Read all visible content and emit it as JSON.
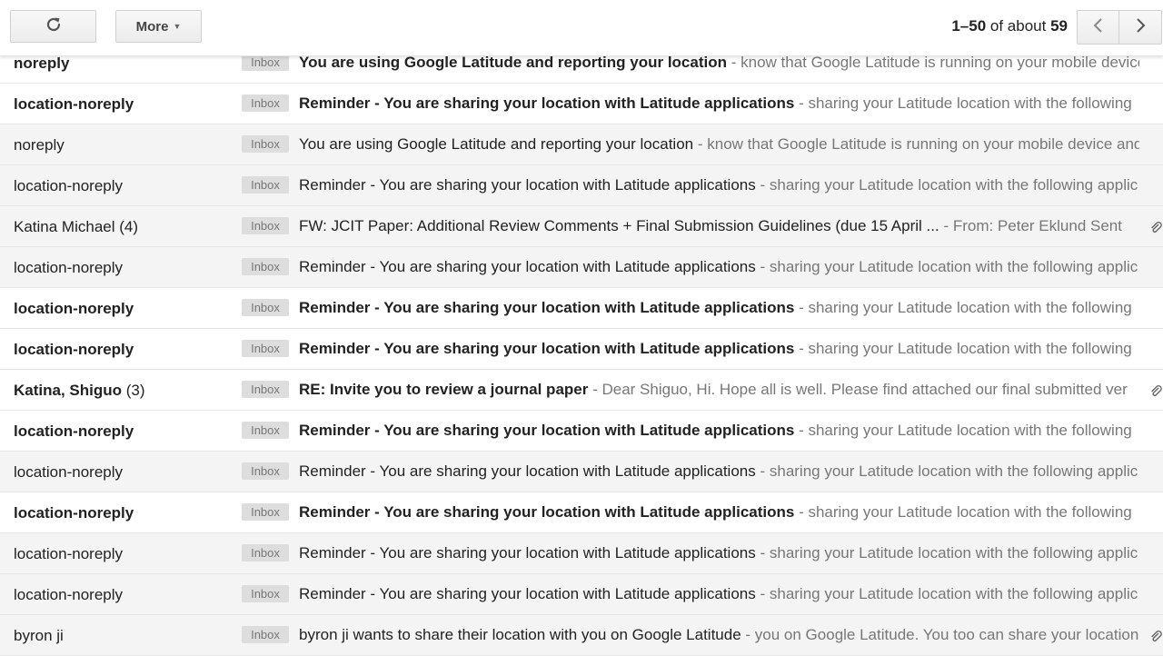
{
  "toolbar": {
    "refresh_icon": "refresh-icon",
    "more_label": "More",
    "pager": {
      "range": "1–50",
      "of_label": "of about",
      "total": "59"
    }
  },
  "emails": [
    {
      "sender": "noreply",
      "count": "",
      "label": "Inbox",
      "subject": "You are using Google Latitude and reporting your location",
      "sep": " - ",
      "snippet": "know that Google Latitude is running on your mobile device and",
      "unread": true,
      "attachment": false
    },
    {
      "sender": "location-noreply",
      "count": "",
      "label": "Inbox",
      "subject": "Reminder - You are sharing your location with Latitude applications",
      "sep": " - ",
      "snippet": "sharing your Latitude location with the following",
      "unread": true,
      "attachment": false
    },
    {
      "sender": "noreply",
      "count": "",
      "label": "Inbox",
      "subject": "You are using Google Latitude and reporting your location",
      "sep": " - ",
      "snippet": "know that Google Latitude is running on your mobile device and",
      "unread": false,
      "attachment": false
    },
    {
      "sender": "location-noreply",
      "count": "",
      "label": "Inbox",
      "subject": "Reminder - You are sharing your location with Latitude applications",
      "sep": " - ",
      "snippet": "sharing your Latitude location with the following applic",
      "unread": false,
      "attachment": false
    },
    {
      "sender": "Katina Michael",
      "count": "(4)",
      "label": "Inbox",
      "subject": "FW: JCIT Paper: Additional Review Comments + Final Submission Guidelines (due 15 April ...",
      "sep": " - ",
      "snippet": " From: Peter Eklund Sent",
      "unread": false,
      "attachment": true
    },
    {
      "sender": "location-noreply",
      "count": "",
      "label": "Inbox",
      "subject": "Reminder - You are sharing your location with Latitude applications",
      "sep": " - ",
      "snippet": "sharing your Latitude location with the following applic",
      "unread": false,
      "attachment": false
    },
    {
      "sender": "location-noreply",
      "count": "",
      "label": "Inbox",
      "subject": "Reminder - You are sharing your location with Latitude applications",
      "sep": " - ",
      "snippet": "sharing your Latitude location with the following",
      "unread": true,
      "attachment": false
    },
    {
      "sender": "location-noreply",
      "count": "",
      "label": "Inbox",
      "subject": "Reminder - You are sharing your location with Latitude applications",
      "sep": " - ",
      "snippet": "sharing your Latitude location with the following",
      "unread": true,
      "attachment": false
    },
    {
      "sender": "Katina, Shiguo",
      "count": "(3)",
      "label": "Inbox",
      "subject": "RE: Invite you to review a journal paper",
      "sep": " - ",
      "snippet": "Dear Shiguo, Hi. Hope all is well. Please find attached our final submitted ver",
      "unread": true,
      "attachment": true
    },
    {
      "sender": "location-noreply",
      "count": "",
      "label": "Inbox",
      "subject": "Reminder - You are sharing your location with Latitude applications",
      "sep": " - ",
      "snippet": "sharing your Latitude location with the following",
      "unread": true,
      "attachment": false
    },
    {
      "sender": "location-noreply",
      "count": "",
      "label": "Inbox",
      "subject": "Reminder - You are sharing your location with Latitude applications",
      "sep": " - ",
      "snippet": "sharing your Latitude location with the following applic",
      "unread": false,
      "attachment": false
    },
    {
      "sender": "location-noreply",
      "count": "",
      "label": "Inbox",
      "subject": "Reminder - You are sharing your location with Latitude applications",
      "sep": " - ",
      "snippet": "sharing your Latitude location with the following",
      "unread": true,
      "attachment": false
    },
    {
      "sender": "location-noreply",
      "count": "",
      "label": "Inbox",
      "subject": "Reminder - You are sharing your location with Latitude applications",
      "sep": " - ",
      "snippet": "sharing your Latitude location with the following applic",
      "unread": false,
      "attachment": false
    },
    {
      "sender": "location-noreply",
      "count": "",
      "label": "Inbox",
      "subject": "Reminder - You are sharing your location with Latitude applications",
      "sep": " - ",
      "snippet": "sharing your Latitude location with the following applic",
      "unread": false,
      "attachment": false
    },
    {
      "sender": "byron ji",
      "count": "",
      "label": "Inbox",
      "subject": "byron ji wants to share their location with you on Google Latitude",
      "sep": " - ",
      "snippet": "you on Google Latitude. You too can share your location",
      "unread": false,
      "attachment": true
    }
  ]
}
